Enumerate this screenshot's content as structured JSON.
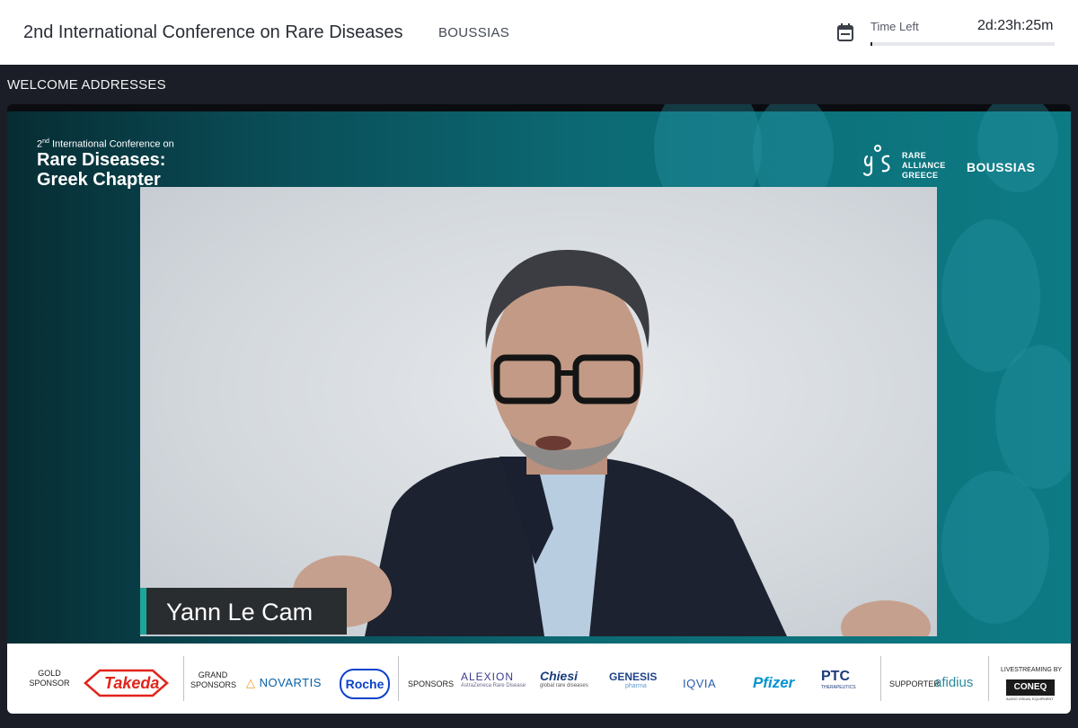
{
  "header": {
    "title": "2nd International Conference on Rare Diseases",
    "organizer": "BOUSSIAS",
    "time_left_label": "Time Left",
    "time_left_value": "2d:23h:25m"
  },
  "section_title": "WELCOME ADDRESSES",
  "stream": {
    "conference_line1": "International Conference on",
    "conference_ordinal": "2",
    "conference_ordinal_suffix": "nd",
    "conference_line2": "Rare Diseases:",
    "conference_line3": "Greek Chapter",
    "partner_logo_lines": [
      "RARE",
      "ALLIANCE",
      "GREECE"
    ],
    "organizer_logo": "BOUSSIAS",
    "speaker_name": "Yann Le Cam"
  },
  "sponsors": {
    "gold_label": [
      "GOLD",
      "SPONSOR"
    ],
    "gold": [
      "Takeda"
    ],
    "grand_label": [
      "GRAND",
      "SPONSORS"
    ],
    "grand": [
      "NOVARTIS",
      "Roche"
    ],
    "sponsors_label": "SPONSORS",
    "sponsors": [
      "ALEXION",
      "AstraZeneca Rare Disease",
      "Chiesi",
      "global rare diseases",
      "GENESIS",
      "pharma",
      "IQVIA",
      "Pfizer",
      "PTC",
      "THERAPEUTICS"
    ],
    "supporter_label": "SUPPORTER",
    "supporter": "afidius",
    "livestream_label": "LIVESTREAMING BY",
    "livestream": "CONEQ",
    "livestream_sub": "AUDIO VISUAL EQUIPMENT"
  },
  "colors": {
    "header_bg": "#ffffff",
    "page_bg": "#1b1e26",
    "accent_teal": "#1ea59b",
    "takeda_red": "#e2231a",
    "novartis_blue": "#0460a9",
    "pfizer_blue": "#0093d0"
  }
}
